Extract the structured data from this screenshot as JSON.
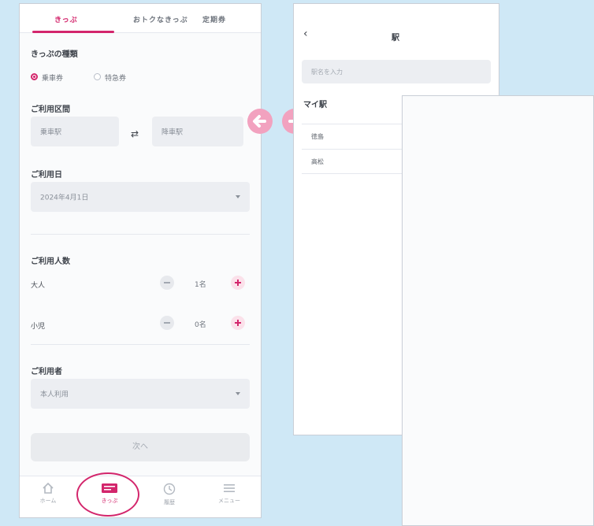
{
  "left_screen": {
    "tabs": [
      {
        "label": "きっぷ",
        "active": true
      },
      {
        "label": "おトクなきっぷ",
        "active": false
      },
      {
        "label": "定期券",
        "active": false
      }
    ],
    "ticket_type": {
      "label": "きっぷの種類",
      "options": [
        {
          "label": "乗車券",
          "selected": true
        },
        {
          "label": "特急券",
          "selected": false
        }
      ]
    },
    "route": {
      "label": "ご利用区間",
      "from_placeholder": "乗車駅",
      "to_placeholder": "降車駅"
    },
    "date": {
      "label": "ご利用日",
      "value": "2024年4月1日"
    },
    "passengers": {
      "label": "ご利用人数",
      "rows": [
        {
          "label": "大人",
          "count": "1名"
        },
        {
          "label": "小児",
          "count": "0名"
        }
      ]
    },
    "user": {
      "label": "ご利用者",
      "value": "本人利用"
    },
    "next_button": "次へ",
    "bottom_nav": [
      {
        "label": "ホーム",
        "icon": "home-icon"
      },
      {
        "label": "きっぷ",
        "icon": "ticket-icon",
        "active": true
      },
      {
        "label": "履歴",
        "icon": "clock-icon"
      },
      {
        "label": "メニュー",
        "icon": "menu-icon"
      }
    ]
  },
  "right_screen": {
    "title": "駅",
    "search_placeholder": "駅名を入力",
    "section_label": "マイ駅",
    "stations": [
      "徳島",
      "高松"
    ]
  },
  "colors": {
    "accent": "#d3266c",
    "background": "#cfe8f6",
    "arrow": "#f2a2bf"
  }
}
